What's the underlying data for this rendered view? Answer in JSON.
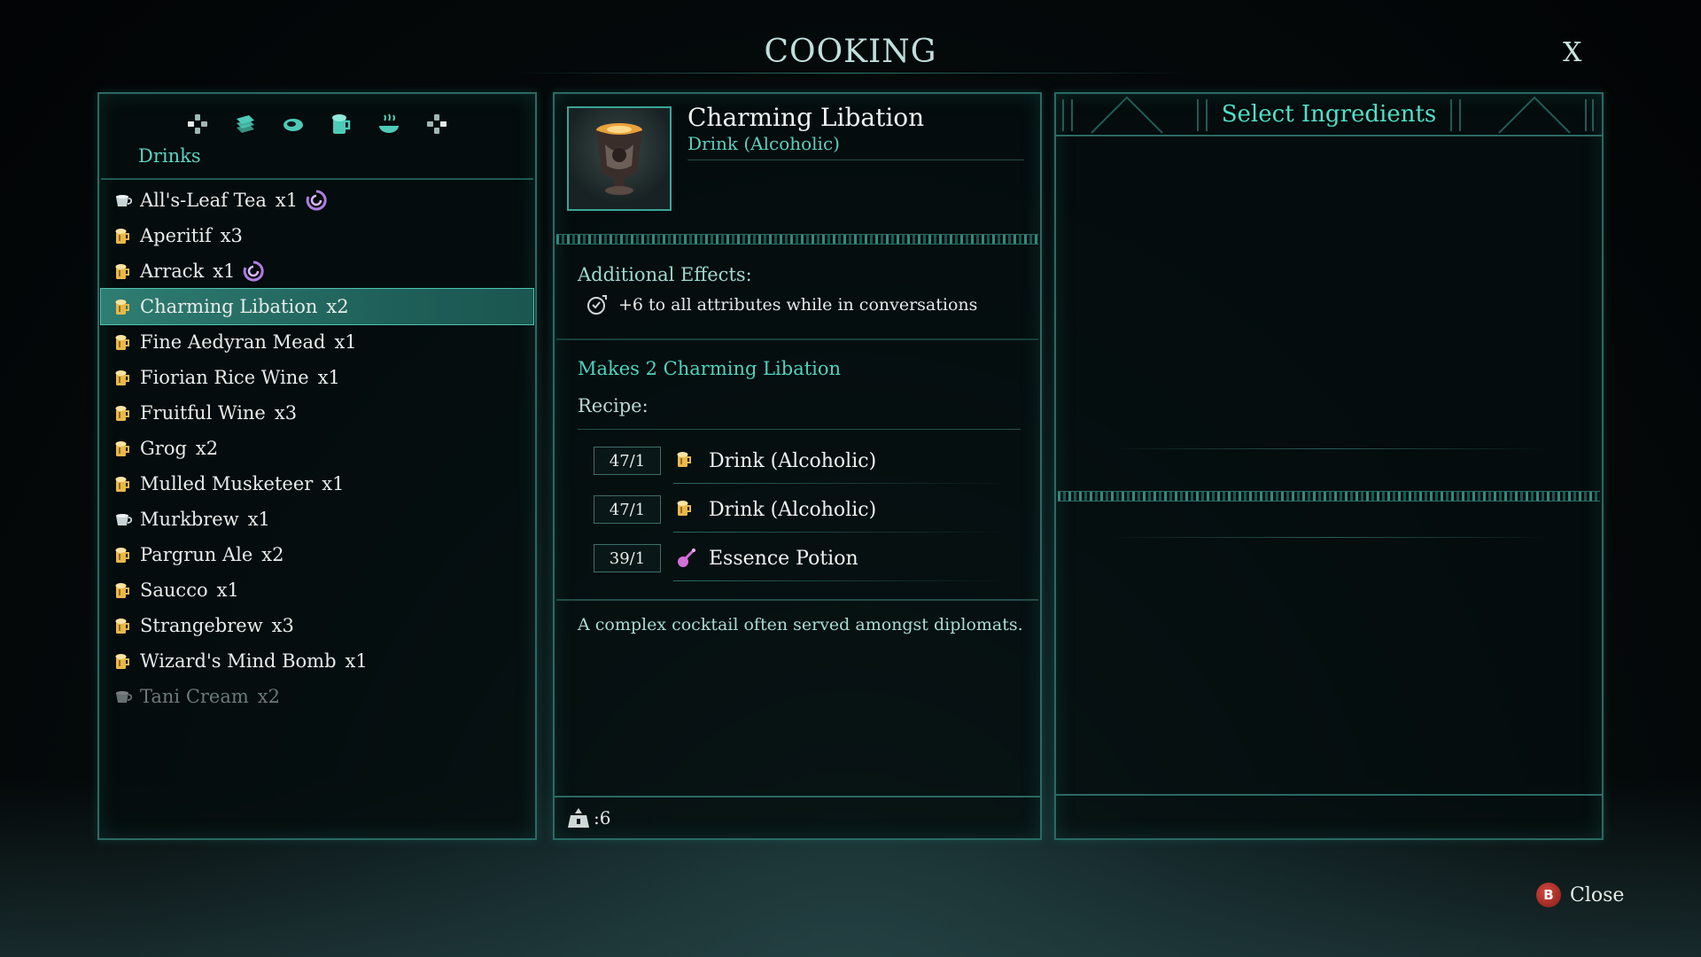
{
  "screen": {
    "title": "COOKING",
    "close_x": "X",
    "close_button": {
      "key": "B",
      "label": "Close"
    }
  },
  "left": {
    "tabs": [
      "dpad-left-icon",
      "scroll-icon",
      "meat-icon",
      "drink-mug-icon",
      "hot-dish-icon",
      "dpad-right-icon"
    ],
    "category": "Drinks",
    "items": [
      {
        "name": "All's-Leaf Tea",
        "qty": "x1",
        "icon": "cup",
        "mark": true,
        "selected": false,
        "dim": false
      },
      {
        "name": "Aperitif",
        "qty": "x3",
        "icon": "mug",
        "mark": false,
        "selected": false,
        "dim": false
      },
      {
        "name": "Arrack",
        "qty": "x1",
        "icon": "mug",
        "mark": true,
        "selected": false,
        "dim": false
      },
      {
        "name": "Charming Libation",
        "qty": "x2",
        "icon": "mug",
        "mark": false,
        "selected": true,
        "dim": false
      },
      {
        "name": "Fine Aedyran Mead",
        "qty": "x1",
        "icon": "mug",
        "mark": false,
        "selected": false,
        "dim": false
      },
      {
        "name": "Fiorian Rice Wine",
        "qty": "x1",
        "icon": "mug",
        "mark": false,
        "selected": false,
        "dim": false
      },
      {
        "name": "Fruitful Wine",
        "qty": "x3",
        "icon": "mug",
        "mark": false,
        "selected": false,
        "dim": false
      },
      {
        "name": "Grog",
        "qty": "x2",
        "icon": "mug",
        "mark": false,
        "selected": false,
        "dim": false
      },
      {
        "name": "Mulled Musketeer",
        "qty": "x1",
        "icon": "mug",
        "mark": false,
        "selected": false,
        "dim": false
      },
      {
        "name": "Murkbrew",
        "qty": "x1",
        "icon": "cup",
        "mark": false,
        "selected": false,
        "dim": false
      },
      {
        "name": "Pargrun Ale",
        "qty": "x2",
        "icon": "mug",
        "mark": false,
        "selected": false,
        "dim": false
      },
      {
        "name": "Saucco",
        "qty": "x1",
        "icon": "mug",
        "mark": false,
        "selected": false,
        "dim": false
      },
      {
        "name": "Strangebrew",
        "qty": "x3",
        "icon": "mug",
        "mark": false,
        "selected": false,
        "dim": false
      },
      {
        "name": "Wizard's Mind Bomb",
        "qty": "x1",
        "icon": "mug",
        "mark": false,
        "selected": false,
        "dim": false
      },
      {
        "name": "Tani Cream",
        "qty": "x2",
        "icon": "cup",
        "mark": false,
        "selected": false,
        "dim": true
      }
    ]
  },
  "detail": {
    "name": "Charming Libation",
    "type": "Drink (Alcoholic)",
    "effects_label": "Additional Effects:",
    "effect": "+6 to all attributes while in conversations",
    "makes": "Makes 2 Charming Libation",
    "recipe_label": "Recipe:",
    "recipe": [
      {
        "count": "47/1",
        "icon": "mug",
        "name": "Drink (Alcoholic)"
      },
      {
        "count": "47/1",
        "icon": "mug",
        "name": "Drink (Alcoholic)"
      },
      {
        "count": "39/1",
        "icon": "potion",
        "name": "Essence Potion"
      }
    ],
    "description": "A complex cocktail often served amongst diplomats.",
    "weight_value": ":6"
  },
  "ingredients": {
    "title": "Select Ingredients"
  },
  "colors": {
    "accent": "#4fe0c8",
    "mug_icon": "#e8b84a",
    "cup_icon": "#c9d4d6",
    "mark_icon": "#b07de0",
    "potion_icon": "#d46fd8"
  }
}
